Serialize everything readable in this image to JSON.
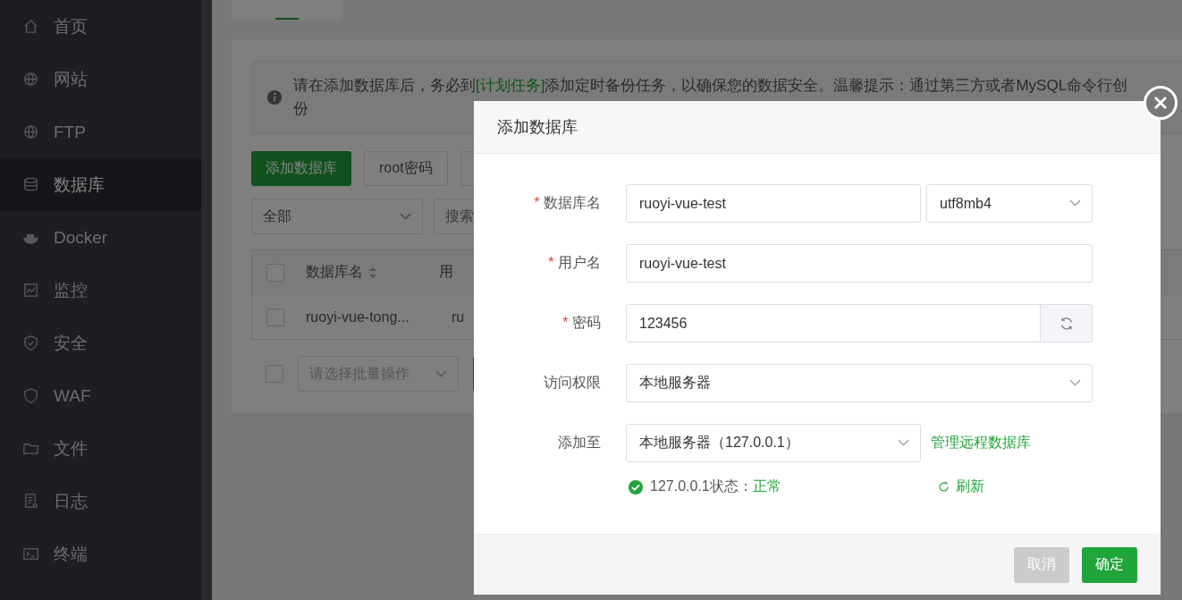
{
  "sidebar": {
    "items": [
      {
        "label": "首页",
        "selected": false
      },
      {
        "label": "网站",
        "selected": false
      },
      {
        "label": "FTP",
        "selected": false
      },
      {
        "label": "数据库",
        "selected": true
      },
      {
        "label": "Docker",
        "selected": false
      },
      {
        "label": "监控",
        "selected": false
      },
      {
        "label": "安全",
        "selected": false
      },
      {
        "label": "WAF",
        "selected": false
      },
      {
        "label": "文件",
        "selected": false
      },
      {
        "label": "日志",
        "selected": false
      },
      {
        "label": "终端",
        "selected": false
      }
    ]
  },
  "page": {
    "notice": {
      "before": "请在添加数据库后，务必到",
      "link": "[计划任务]",
      "after": "添加定时备份任务，以确保您的数据安全。温馨提示：通过第三方或者MySQL命令行创",
      "line2": "份"
    },
    "buttons": [
      "添加数据库",
      "root密码"
    ],
    "filter": "全部",
    "search_placeholder": "搜索",
    "table": {
      "all_checked": false,
      "columns": [
        "数据库名",
        "用"
      ],
      "rows": [
        {
          "checked": false,
          "cells": [
            "ruoyi-vue-tong...",
            "ru"
          ]
        }
      ]
    },
    "batch_checked": false,
    "batch_placeholder": "请选择批量操作"
  },
  "dialog": {
    "title": "添加数据库",
    "fields": [
      {
        "kind": "input_select",
        "required_mark": "*",
        "label": "数据库名",
        "value": "ruoyi-vue-test",
        "select": "utf8mb4"
      },
      {
        "kind": "input",
        "required_mark": "*",
        "label": "用户名",
        "value": "ruoyi-vue-test"
      },
      {
        "kind": "password",
        "required_mark": "*",
        "label": "密码",
        "value": "123456"
      },
      {
        "kind": "select",
        "label": "访问权限",
        "value": "本地服务器"
      },
      {
        "kind": "select_link",
        "label": "添加至",
        "value": "本地服务器（127.0.0.1）",
        "link": "管理远程数据库"
      }
    ],
    "status": {
      "label": "127.0.0.1状态：",
      "value": "正常",
      "ok": true,
      "refresh": "刷新"
    },
    "buttons": [
      {
        "kind": "cancel",
        "label": "取消"
      },
      {
        "kind": "confirm",
        "label": "确定"
      }
    ]
  }
}
